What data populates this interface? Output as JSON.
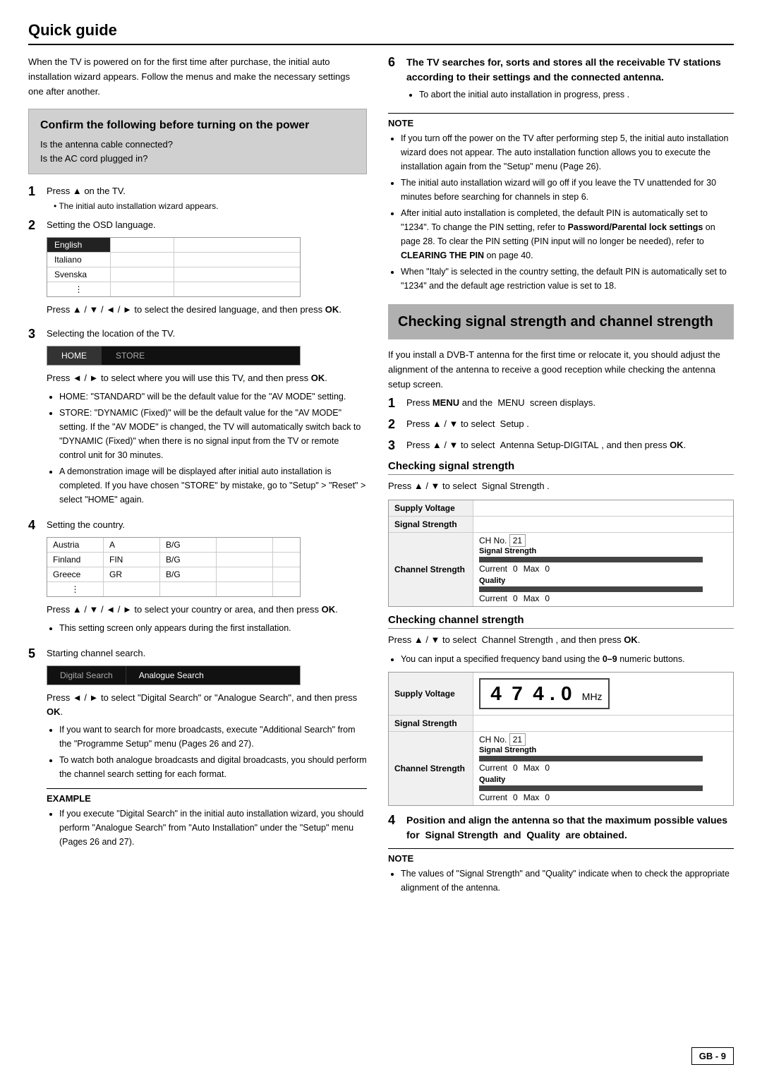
{
  "page": {
    "title": "Quick guide"
  },
  "intro": "When the TV is powered on for the first time after purchase, the initial auto installation wizard appears. Follow the menus and make the necessary settings one after another.",
  "confirm_box": {
    "heading": "Confirm the following before turning on the power",
    "lines": [
      "Is the antenna cable connected?",
      "Is the AC cord plugged in?"
    ]
  },
  "steps_left": [
    {
      "num": "1",
      "text": "Press ▲ on the TV.",
      "sub": "The initial auto installation wizard appears."
    },
    {
      "num": "2",
      "text": "Setting the OSD language."
    },
    {
      "num": "3",
      "text": "Selecting the location of the TV."
    },
    {
      "num": "4",
      "text": "Setting the country."
    },
    {
      "num": "5",
      "text": "Starting channel search."
    }
  ],
  "language_options": [
    {
      "label": "English",
      "selected": true
    },
    {
      "label": "Italiano",
      "selected": false
    },
    {
      "label": "Svenska",
      "selected": false
    }
  ],
  "language_note": "Press ▲ / ▼ / ◄ / ► to select the desired language, and then press OK.",
  "location_options": [
    {
      "label": "HOME",
      "active": false
    },
    {
      "label": "STORE",
      "active": false
    }
  ],
  "location_note": "Press ◄ / ► to select where you will use this TV, and then press OK.",
  "location_bullets": [
    "HOME: \"STANDARD\" will be the default value for the \"AV MODE\" setting.",
    "STORE: \"DYNAMIC (Fixed)\" will be the default value for the \"AV MODE\" setting. If the \"AV MODE\" is changed, the TV will automatically switch back to \"DYNAMIC (Fixed)\" when there is no signal input from the TV or remote control unit for 30 minutes.",
    "A demonstration image will be displayed after initial auto installation is completed. If you have chosen \"STORE\" by mistake, go to \"Setup\" > \"Reset\" > select \"HOME\" again."
  ],
  "country_options": [
    {
      "col1": "Austria",
      "col2": "A",
      "col3": "B/G"
    },
    {
      "col1": "Finland",
      "col2": "FIN",
      "col3": "B/G"
    },
    {
      "col1": "Greece",
      "col2": "GR",
      "col3": "B/G"
    }
  ],
  "country_note": "Press ▲ / ▼ / ◄ / ► to select your country or area, and then press OK.",
  "country_sub": "This setting screen only appears during the first installation.",
  "search_options": [
    {
      "label": "Digital Search"
    },
    {
      "label": "Analogue Search"
    }
  ],
  "search_note": "Press ◄ / ► to select \"Digital Search\" or \"Analogue Search\", and then press OK.",
  "search_bullets": [
    "If you want to search for more broadcasts, execute \"Additional Search\" from the \"Programme Setup\" menu (Pages 26 and 27).",
    "To watch both analogue broadcasts and digital broadcasts, you should perform the channel search setting for each format."
  ],
  "example": {
    "label": "EXAMPLE",
    "bullets": [
      "If you execute \"Digital Search\" in the initial auto installation wizard, you should perform \"Analogue Search\" from \"Auto Installation\" under the \"Setup\" menu (Pages 26 and 27)."
    ]
  },
  "right_intro": "The TV searches for, sorts and stores all the receivable TV stations according to their settings and the connected antenna.",
  "right_intro_sub": "To abort the initial auto installation in progress, press .",
  "note_right": {
    "label": "NOTE",
    "bullets": [
      "If you turn off the power on the TV after performing step 5, the initial auto installation wizard does not appear. The auto installation function allows you to execute the installation again from the \"Setup\" menu (Page 26).",
      "The initial auto installation wizard will go off if you leave the TV unattended for 30 minutes before searching for channels in step 6.",
      "After initial auto installation is completed, the default PIN is automatically set to \"1234\". To change the PIN setting, refer to Password/Parental lock settings on page 28. To clear the PIN setting (PIN input will no longer be needed), refer to CLEARING THE PIN on page 40.",
      "When \"Italy\" is selected in the country setting, the default PIN is automatically set to \"1234\" and the default age restriction value is set to 18."
    ]
  },
  "section_heading": {
    "title": "Checking signal strength and channel strength"
  },
  "section_intro": "If you install a DVB-T antenna for the first time or relocate it, you should adjust the alignment of the antenna to receive a good reception while checking the antenna setup screen.",
  "steps_right": [
    {
      "num": "1",
      "text": "Press MENU and the  MENU  screen displays."
    },
    {
      "num": "2",
      "text": "Press  /  to select  Setup ."
    },
    {
      "num": "3",
      "text": "Press  /  to select  Antenna Setup-DIGITAL , and then press OK."
    }
  ],
  "checking_signal": {
    "heading": "Checking signal strength",
    "press_line": "Press  /  to select  Signal Strength .",
    "table_rows": [
      {
        "label": "Supply Voltage",
        "content": ""
      },
      {
        "label": "Signal Strength",
        "content": "bar"
      },
      {
        "label": "Channel Strength",
        "content": "detail"
      }
    ],
    "ch_no": "21",
    "current1": "0",
    "max1": "0",
    "current2": "0",
    "max2": "0"
  },
  "checking_channel": {
    "heading": "Checking channel strength",
    "press_line": "Press  /  to select  Channel Strength , and then press OK.",
    "bullet": "You can input a specified frequency band using the 0–9 numeric buttons.",
    "freq_digits": [
      "4",
      "7",
      "4",
      ".",
      "0"
    ],
    "freq_unit": "MHz",
    "ch_no": "21",
    "current1": "0",
    "max1": "0",
    "current2": "0",
    "max2": "0"
  },
  "step4_right": {
    "num": "4",
    "text": "Position and align the antenna so that the maximum possible values for  Signal Strength  and  Quality  are obtained."
  },
  "note_bottom": {
    "label": "NOTE",
    "bullet": "The values of \"Signal Strength\" and \"Quality\" indicate when to check the appropriate alignment of the antenna."
  },
  "badge": "GB - 9"
}
